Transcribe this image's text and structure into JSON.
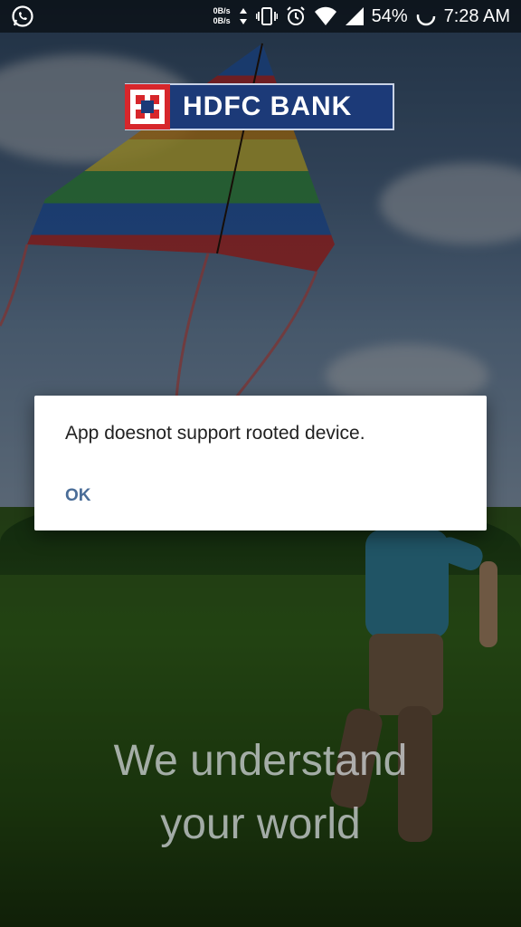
{
  "status_bar": {
    "net_up": "0B/s",
    "net_down": "0B/s",
    "battery": "54%",
    "time": "7:28 AM"
  },
  "logo": {
    "text": "HDFC BANK"
  },
  "tagline": {
    "line1": "We understand",
    "line2": "your world"
  },
  "dialog": {
    "message": "App doesnot support rooted device.",
    "ok_label": "OK"
  },
  "colors": {
    "dialog_button": "#4a6d98",
    "logo_blue": "#1c3a78",
    "logo_red": "#d7262b"
  }
}
